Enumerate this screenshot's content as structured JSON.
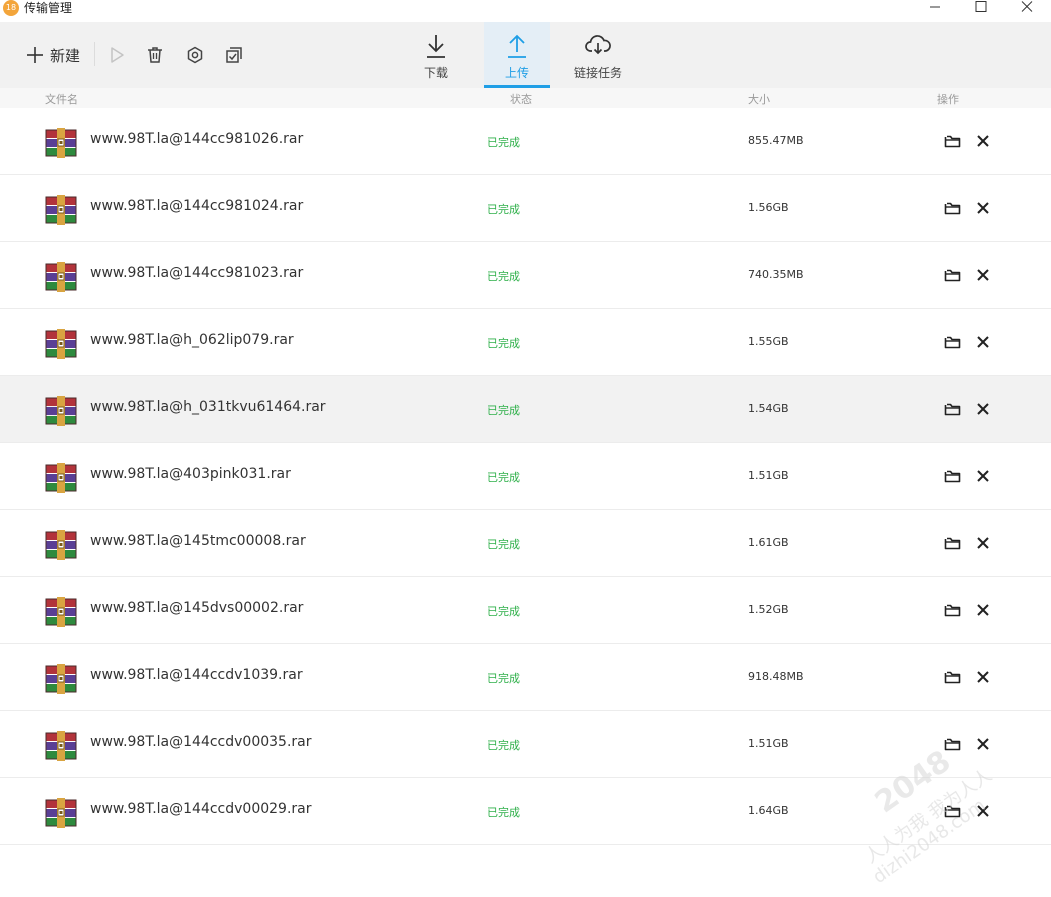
{
  "window": {
    "app_icon_text": "18",
    "title": "传输管理"
  },
  "toolbar": {
    "new_label": "新建",
    "tabs": [
      {
        "label": "下载",
        "icon": "download-icon",
        "active": false
      },
      {
        "label": "上传",
        "icon": "upload-icon",
        "active": true
      },
      {
        "label": "链接任务",
        "icon": "cloud-download-icon",
        "active": false
      }
    ]
  },
  "columns": {
    "name": "文件名",
    "status": "状态",
    "size": "大小",
    "actions": "操作"
  },
  "files": [
    {
      "name": "www.98T.la@144cc981026.rar",
      "status": "已完成",
      "size": "855.47MB"
    },
    {
      "name": "www.98T.la@144cc981024.rar",
      "status": "已完成",
      "size": "1.56GB"
    },
    {
      "name": "www.98T.la@144cc981023.rar",
      "status": "已完成",
      "size": "740.35MB"
    },
    {
      "name": "www.98T.la@h_062lip079.rar",
      "status": "已完成",
      "size": "1.55GB"
    },
    {
      "name": "www.98T.la@h_031tkvu61464.rar",
      "status": "已完成",
      "size": "1.54GB"
    },
    {
      "name": "www.98T.la@403pink031.rar",
      "status": "已完成",
      "size": "1.51GB"
    },
    {
      "name": "www.98T.la@145tmc00008.rar",
      "status": "已完成",
      "size": "1.61GB"
    },
    {
      "name": "www.98T.la@145dvs00002.rar",
      "status": "已完成",
      "size": "1.52GB"
    },
    {
      "name": "www.98T.la@144ccdv1039.rar",
      "status": "已完成",
      "size": "918.48MB"
    },
    {
      "name": "www.98T.la@144ccdv00035.rar",
      "status": "已完成",
      "size": "1.51GB"
    },
    {
      "name": "www.98T.la@144ccdv00029.rar",
      "status": "已完成",
      "size": "1.64GB"
    }
  ],
  "watermark": {
    "number": "2048",
    "line1": "人人为我 我为人人",
    "line2": "dizhi2048.com"
  },
  "colors": {
    "accent": "#1e9ee6",
    "status_done": "#2fb04a",
    "toolbar_bg": "#f1f1f1",
    "hover_row": "#f2f2f2"
  }
}
